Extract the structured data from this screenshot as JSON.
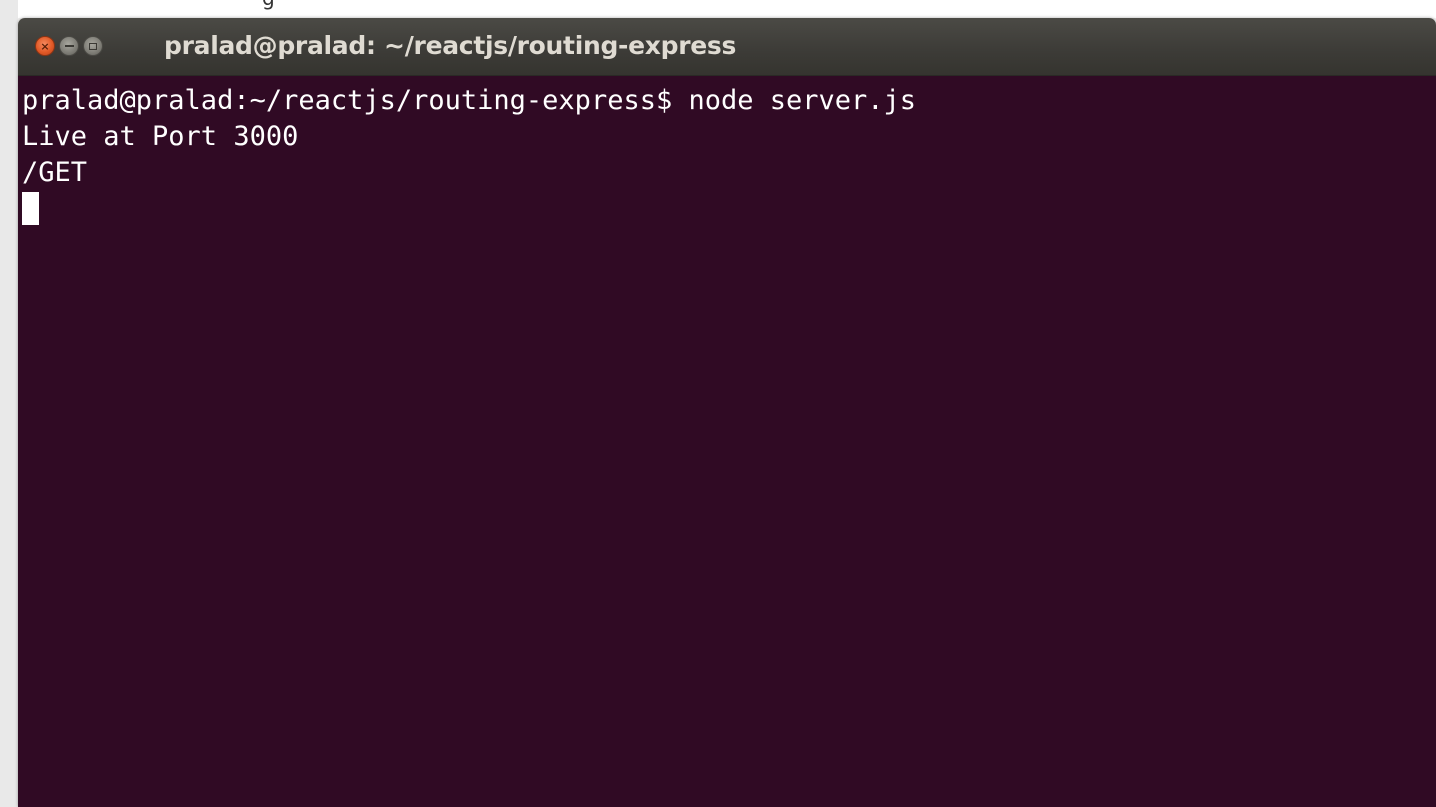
{
  "background": {
    "partial_text": "g"
  },
  "window": {
    "title": "pralad@pralad: ~/reactjs/routing-express",
    "buttons": {
      "close_glyph": "×",
      "minimize": "minimize",
      "maximize": "maximize"
    }
  },
  "terminal": {
    "lines": [
      "pralad@pralad:~/reactjs/routing-express$ node server.js",
      "Live at Port 3000",
      "/GET"
    ],
    "background_color": "#300a24",
    "text_color": "#ffffff"
  },
  "colors": {
    "titlebar": "#3c3b37",
    "close_button": "#e25a27",
    "title_text": "#dfdbd2"
  }
}
